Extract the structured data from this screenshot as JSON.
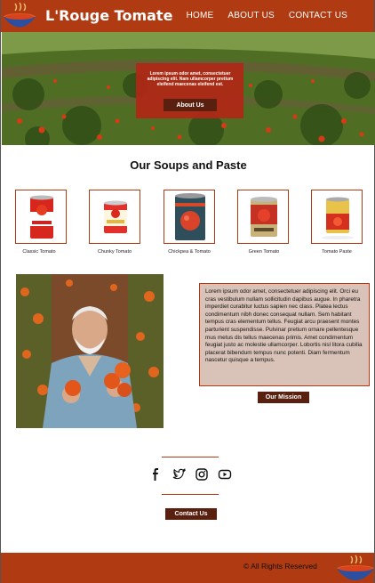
{
  "header": {
    "brand": "L'Rouge Tomate",
    "nav": [
      "HOME",
      "ABOUT US",
      "CONTACT US"
    ]
  },
  "hero": {
    "text": "Lorem ipsum odor amet, consectetuer adipiscing elit. Nam ullamcorper pretium eleifend maecenas eleifend est.",
    "button": "About Us"
  },
  "products": {
    "title": "Our Soups and Paste",
    "items": [
      {
        "label": "Classic Tomato"
      },
      {
        "label": "Chunky Tomato"
      },
      {
        "label": "Chickpea & Tomato"
      },
      {
        "label": "Green Tomato"
      },
      {
        "label": "Tomato Paste"
      }
    ]
  },
  "mission": {
    "text": "Lorem ipsum odor amet, consectetuer adipiscing elit. Orci eu cras vestibulum nullam sollicitudin dapibus augue. In pharetra imperdiet curabitur luctus sapien nec class. Platea lectus condimentum nibh donec consequat nullam. Sem habitant tempus cras elementum tellus. Feugiat arcu praesent montes parturient suspendisse. Pulvinar pretium ornare pellentesque mus metus dis tellus maecenas primis. Amet condimentum feugiat justo ac molestie ullamcorper. Lobortis nisl litora cubilia placerat bibendum tempus nunc potenti. Diam fermentum nascetur quisque a tempus.",
    "button": "Our Mission"
  },
  "social": {
    "icons": [
      "facebook-icon",
      "twitter-icon",
      "instagram-icon",
      "youtube-icon"
    ],
    "contact_button": "Contact Us"
  },
  "footer": {
    "copyright": "© All Rights Reserved"
  },
  "colors": {
    "brand": "#b03a12",
    "button": "#5a200f",
    "info_bg": "#d9c3b8"
  }
}
